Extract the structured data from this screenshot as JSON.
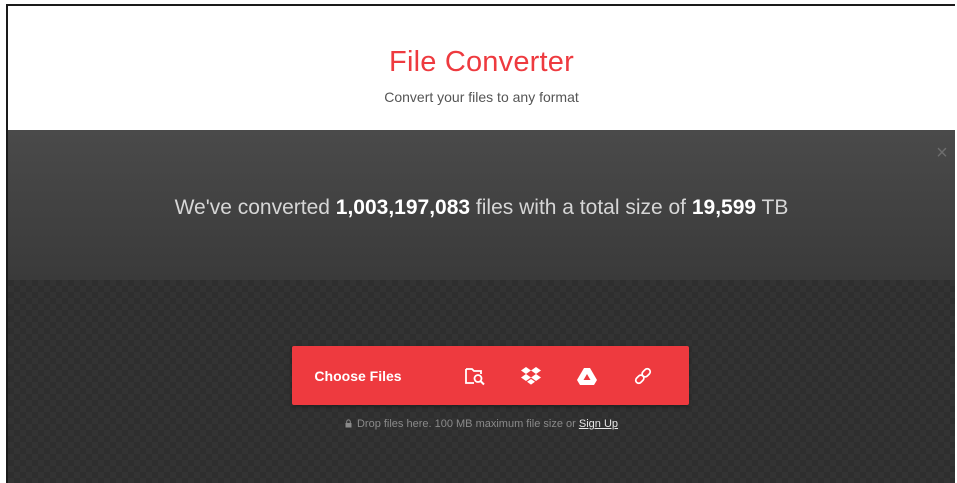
{
  "header": {
    "title": "File Converter",
    "subtitle": "Convert your files to any format"
  },
  "stats": {
    "prefix": "We've converted ",
    "file_count": "1,003,197,083",
    "middle": " files with a total size of ",
    "total_size": "19,599",
    "unit": " TB",
    "close_icon": "close-icon"
  },
  "upload": {
    "choose_label": "Choose Files",
    "sources": [
      {
        "icon": "folder-search-icon",
        "label": "From Device"
      },
      {
        "icon": "dropbox-icon",
        "label": "From Dropbox"
      },
      {
        "icon": "google-drive-icon",
        "label": "From Google Drive"
      },
      {
        "icon": "link-icon",
        "label": "From URL"
      }
    ],
    "hint_text": "Drop files here. 100 MB maximum file size or ",
    "signup_label": "Sign Up"
  },
  "colors": {
    "accent": "#ee3a3f",
    "stats_bg": "#444444",
    "drop_bg": "#2e2e2e"
  }
}
